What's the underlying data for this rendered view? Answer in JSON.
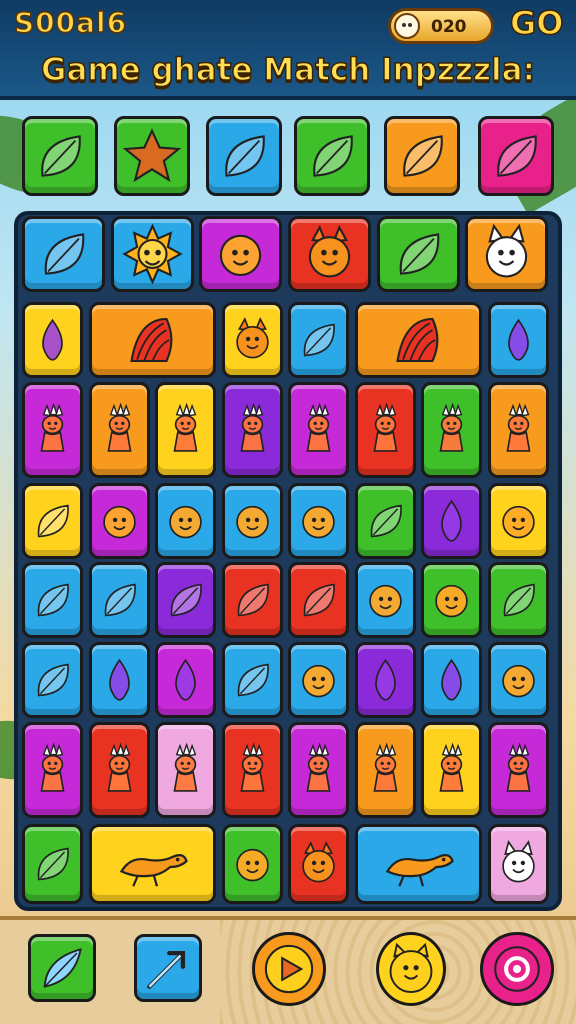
{
  "header": {
    "score": "S00al6",
    "coins": "020",
    "go_label": "GO",
    "title": "Game ghate Match Inpzzzla:"
  },
  "colors": {
    "green": "#3fbf2a",
    "blue": "#2aa8e8",
    "orange": "#f79a1e",
    "red": "#e83222",
    "pink": "#e8228a",
    "yellow": "#ffd21e",
    "purple": "#8a2ad8",
    "magenta": "#c62ad8",
    "lightpink": "#f0a8e0"
  },
  "top_row": [
    {
      "color": "green",
      "icon": "leaf-icon"
    },
    {
      "color": "green",
      "icon": "star-icon"
    },
    {
      "color": "blue",
      "icon": "leaf-icon"
    },
    {
      "color": "green",
      "icon": "leaf-icon"
    },
    {
      "color": "orange",
      "icon": "leaf-icon"
    },
    {
      "color": "pink",
      "icon": "leaf-icon"
    }
  ],
  "board_rows": [
    [
      {
        "color": "blue",
        "icon": "leaf-icon",
        "span": 1
      },
      {
        "color": "blue",
        "icon": "sun-icon",
        "span": 1
      },
      {
        "color": "magenta",
        "icon": "face-icon",
        "span": 1
      },
      {
        "color": "red",
        "icon": "fox-face-icon",
        "span": 1
      },
      {
        "color": "green",
        "icon": "leaf-icon",
        "span": 1
      },
      {
        "color": "orange",
        "icon": "cat-face-icon",
        "span": 1
      }
    ],
    [
      {
        "color": "yellow",
        "icon": "drop-icon",
        "span": 1
      },
      {
        "color": "orange",
        "icon": "shell-icon",
        "span": 2
      },
      {
        "color": "yellow",
        "icon": "fox-face-icon",
        "span": 1
      },
      {
        "color": "blue",
        "icon": "leaf-icon",
        "span": 1
      },
      {
        "color": "orange",
        "icon": "shell-icon",
        "span": 2
      },
      {
        "color": "blue",
        "icon": "drop-icon",
        "span": 1
      }
    ],
    [
      {
        "color": "magenta",
        "icon": "creature-icon",
        "span": 1
      },
      {
        "color": "orange",
        "icon": "creature-icon",
        "span": 1
      },
      {
        "color": "yellow",
        "icon": "creature-icon",
        "span": 1
      },
      {
        "color": "purple",
        "icon": "creature-icon",
        "span": 1
      },
      {
        "color": "magenta",
        "icon": "creature-icon",
        "span": 1
      },
      {
        "color": "red",
        "icon": "creature-icon",
        "span": 1
      },
      {
        "color": "green",
        "icon": "creature-icon",
        "span": 1
      },
      {
        "color": "orange",
        "icon": "creature-icon",
        "span": 1
      }
    ],
    [
      {
        "color": "yellow",
        "icon": "leaf-icon",
        "span": 1
      },
      {
        "color": "magenta",
        "icon": "face-icon",
        "span": 1
      },
      {
        "color": "blue",
        "icon": "face-icon",
        "span": 1
      },
      {
        "color": "blue",
        "icon": "face-icon",
        "span": 1
      },
      {
        "color": "blue",
        "icon": "face-icon",
        "span": 1
      },
      {
        "color": "green",
        "icon": "leaf-icon",
        "span": 1
      },
      {
        "color": "purple",
        "icon": "drop-icon",
        "span": 1
      },
      {
        "color": "yellow",
        "icon": "face-icon",
        "span": 1
      }
    ],
    [
      {
        "color": "blue",
        "icon": "leaf-icon",
        "span": 1
      },
      {
        "color": "blue",
        "icon": "leaf-icon",
        "span": 1
      },
      {
        "color": "purple",
        "icon": "leaf-icon",
        "span": 1
      },
      {
        "color": "red",
        "icon": "leaf-icon",
        "span": 1
      },
      {
        "color": "red",
        "icon": "leaf-icon",
        "span": 1
      },
      {
        "color": "blue",
        "icon": "face-icon",
        "span": 1
      },
      {
        "color": "green",
        "icon": "face-icon",
        "span": 1
      },
      {
        "color": "green",
        "icon": "leaf-icon",
        "span": 1
      }
    ],
    [
      {
        "color": "blue",
        "icon": "leaf-icon",
        "span": 1
      },
      {
        "color": "blue",
        "icon": "drop-icon",
        "span": 1
      },
      {
        "color": "magenta",
        "icon": "drop-icon",
        "span": 1
      },
      {
        "color": "blue",
        "icon": "leaf-icon",
        "span": 1
      },
      {
        "color": "blue",
        "icon": "face-icon",
        "span": 1
      },
      {
        "color": "purple",
        "icon": "drop-icon",
        "span": 1
      },
      {
        "color": "blue",
        "icon": "drop-icon",
        "span": 1
      },
      {
        "color": "blue",
        "icon": "face-icon",
        "span": 1
      }
    ],
    [
      {
        "color": "magenta",
        "icon": "creature-icon",
        "span": 1
      },
      {
        "color": "red",
        "icon": "creature-icon",
        "span": 1
      },
      {
        "color": "lightpink",
        "icon": "creature-icon",
        "span": 1
      },
      {
        "color": "red",
        "icon": "creature-icon",
        "span": 1
      },
      {
        "color": "magenta",
        "icon": "creature-icon",
        "span": 1
      },
      {
        "color": "orange",
        "icon": "creature-icon",
        "span": 1
      },
      {
        "color": "yellow",
        "icon": "creature-icon",
        "span": 1
      },
      {
        "color": "magenta",
        "icon": "creature-icon",
        "span": 1
      }
    ],
    [
      {
        "color": "green",
        "icon": "leaf-icon",
        "span": 1
      },
      {
        "color": "yellow",
        "icon": "lizard-icon",
        "span": 2
      },
      {
        "color": "green",
        "icon": "face-icon",
        "span": 1
      },
      {
        "color": "red",
        "icon": "fox-face-icon",
        "span": 1
      },
      {
        "color": "blue",
        "icon": "lizard-icon",
        "span": 2
      },
      {
        "color": "lightpink",
        "icon": "cat-face-icon",
        "span": 1
      }
    ]
  ],
  "bottom_bar": [
    {
      "name": "leaf-powerup-button",
      "color": "green",
      "icon": "feather-icon"
    },
    {
      "name": "arrow-powerup-button",
      "color": "blue",
      "icon": "arrow-icon"
    },
    {
      "name": "play-button",
      "color": "orange",
      "icon": "play-icon"
    },
    {
      "name": "hint-button",
      "color": "yellow",
      "icon": "smiley-icon"
    },
    {
      "name": "settings-button",
      "color": "pink",
      "icon": "power-icon"
    }
  ]
}
